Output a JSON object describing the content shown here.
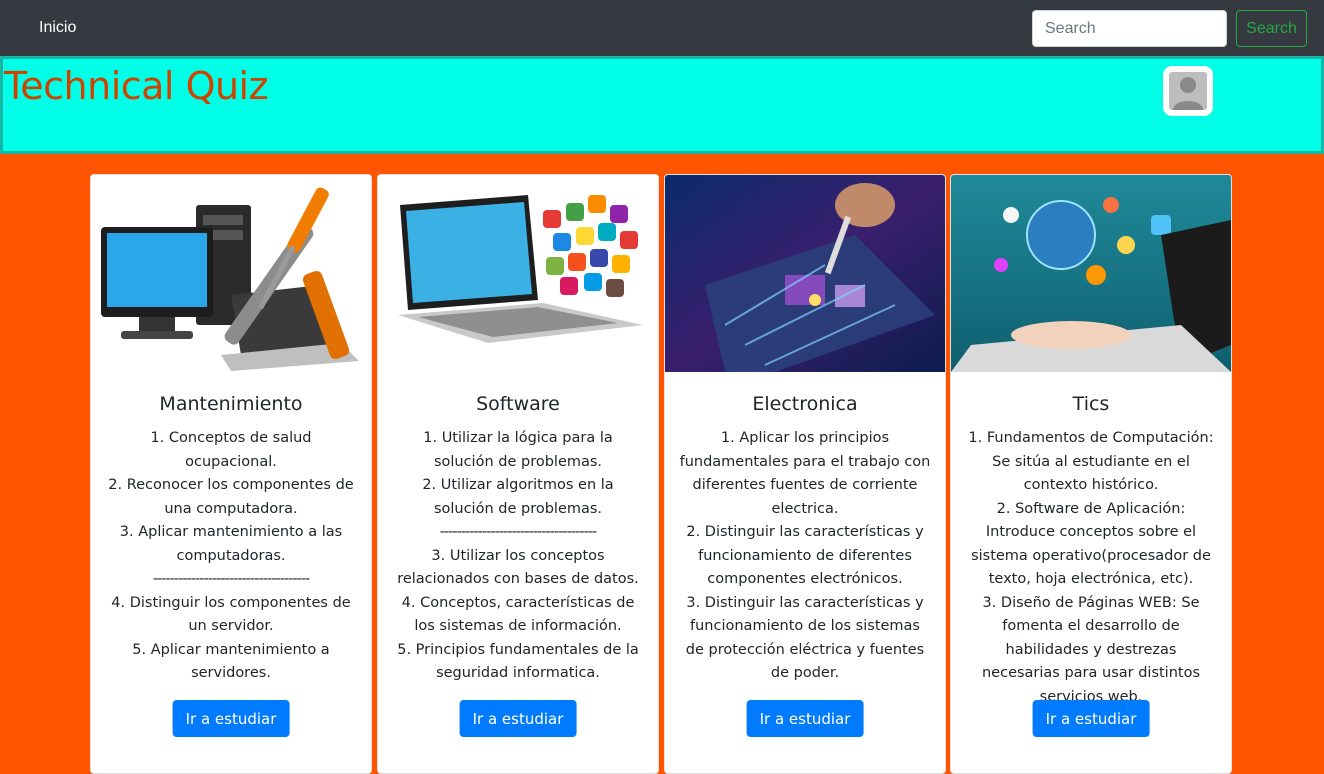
{
  "navbar": {
    "home_label": "Inicio",
    "search_placeholder": "Search",
    "search_button_label": "Search"
  },
  "header": {
    "title": "Technical Quiz",
    "avatar_icon": "user-avatar-icon"
  },
  "colors": {
    "page_background": "#ff5500",
    "header_background": "#00ffe6",
    "title_color": "#cc4400",
    "navbar": "#343a40",
    "primary_button": "#007bff",
    "search_button": "#28a745"
  },
  "cards": [
    {
      "title": "Mantenimiento",
      "image": "computer-maintenance-tools-image",
      "lines": [
        "1. Conceptos de salud ocupacional.",
        "2. Reconocer los componentes de una computadora.",
        "3. Aplicar mantenimiento a las computadoras.",
        "-------------------------------------",
        "4. Distinguir los componentes de un servidor.",
        "5. Aplicar mantenimiento a servidores."
      ],
      "button_label": "Ir a estudiar"
    },
    {
      "title": "Software",
      "image": "laptop-app-icons-image",
      "lines": [
        "1. Utilizar la lógica para la solución de problemas.",
        "2. Utilizar algoritmos en la solución de problemas.",
        "-------------------------------------",
        "3. Utilizar los conceptos relacionados con bases de datos.",
        "4. Conceptos, características de los sistemas de información.",
        "5. Principios fundamentales de la seguridad informatica."
      ],
      "button_label": "Ir a estudiar"
    },
    {
      "title": "Electronica",
      "image": "circuit-board-soldering-image",
      "lines": [
        "1. Aplicar los principios fundamentales para el trabajo con diferentes fuentes de corriente electrica.",
        "2. Distinguir las características y funcionamiento de diferentes componentes electrónicos.",
        "3. Distinguir las características y funcionamiento de los sistemas de protección eléctrica y fuentes de poder."
      ],
      "button_label": "Ir a estudiar"
    },
    {
      "title": "Tics",
      "image": "laptop-digital-globe-image",
      "lines": [
        "1. Fundamentos de Computación: Se sitúa al estudiante en el contexto histórico.",
        "2. Software de Aplicación: Introduce conceptos sobre el sistema operativo(procesador de texto, hoja electrónica, etc).",
        "3. Diseño de Páginas WEB: Se fomenta el desarrollo de habilidades y destrezas necesarias para usar distintos servicios web."
      ],
      "button_label": "Ir a estudiar"
    }
  ]
}
